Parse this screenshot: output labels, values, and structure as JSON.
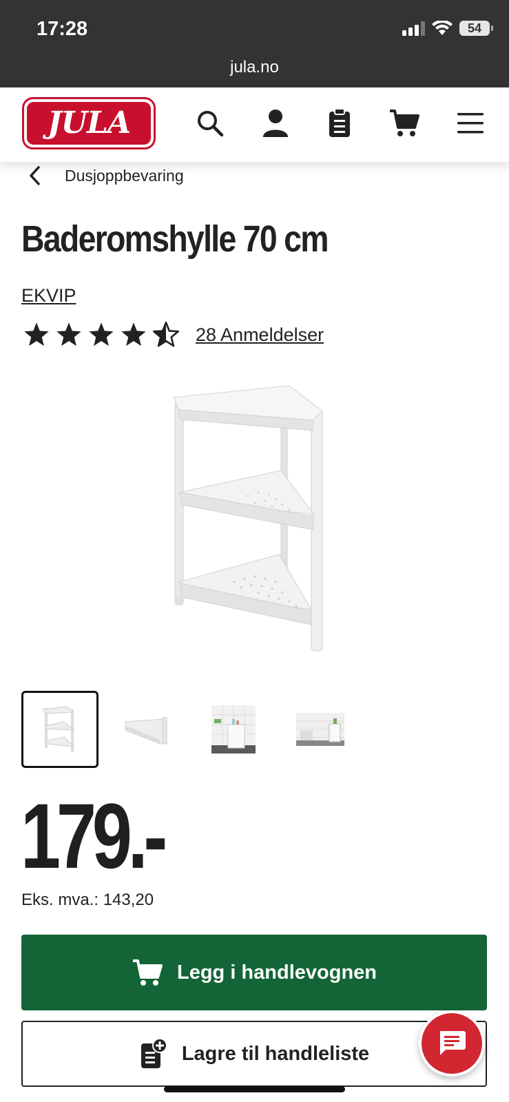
{
  "status_bar": {
    "time": "17:28",
    "battery": "54",
    "url": "jula.no"
  },
  "header": {
    "logo_text": "JULA",
    "icons": [
      "search-icon",
      "account-icon",
      "shopping-list-icon",
      "cart-icon",
      "menu-icon"
    ]
  },
  "breadcrumb": {
    "label": "Dusjoppbevaring"
  },
  "product": {
    "title": "Baderomshylle 70 cm",
    "brand": "EKVIP",
    "rating": 4.5,
    "reviews_label": "28 Anmeldelser",
    "thumbnail_count": 4,
    "selected_thumbnail": 1,
    "price": "179.-",
    "ex_vat": "Eks. mva.: 143,20"
  },
  "actions": {
    "add_to_cart": "Legg i handlevognen",
    "save_to_list": "Lagre til handleliste"
  },
  "colors": {
    "brand_red": "#c8102e",
    "primary_green": "#136436",
    "chat_red": "#d22631",
    "status_bar": "#333334"
  }
}
